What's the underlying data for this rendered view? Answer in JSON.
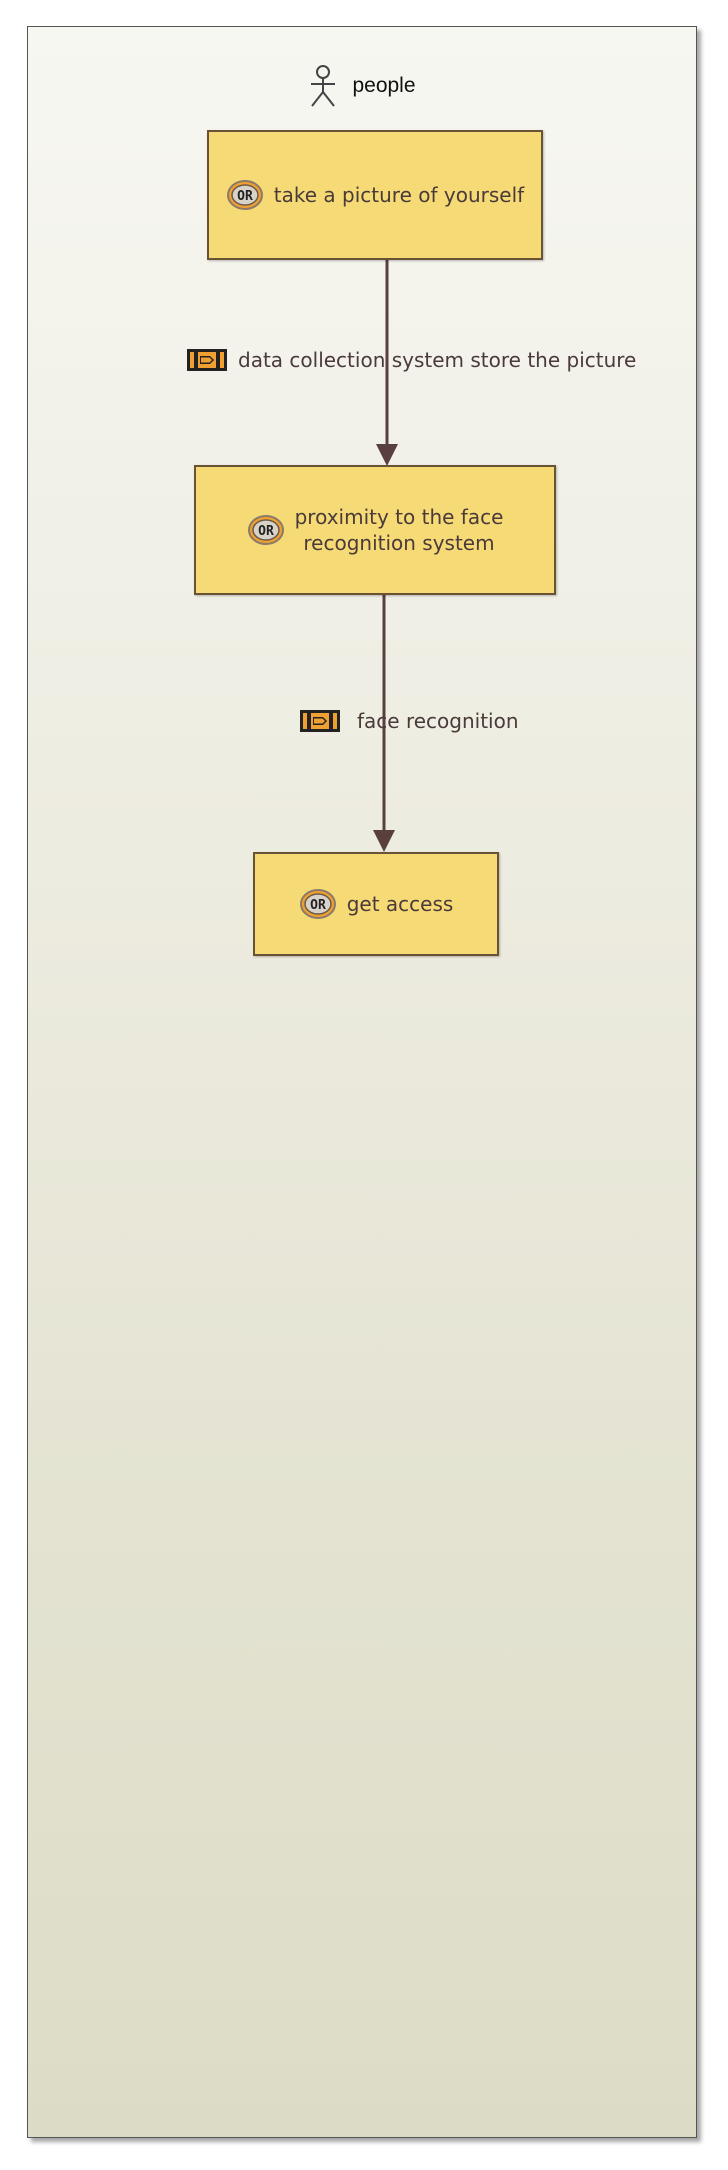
{
  "lane": {
    "title": "people",
    "icon": "actor-icon"
  },
  "nodes": [
    {
      "id": "n1",
      "label": "take a picture of yourself",
      "icon": "or-icon"
    },
    {
      "id": "n2",
      "label": "proximity to the face recognition system",
      "label_line1": "proximity to the face",
      "label_line2": "recognition system",
      "icon": "or-icon"
    },
    {
      "id": "n3",
      "label": "get access",
      "icon": "or-icon"
    }
  ],
  "edges": [
    {
      "from": "n1",
      "to": "n2",
      "label": "data collection system store the picture",
      "icon": "flag-icon"
    },
    {
      "from": "n2",
      "to": "n3",
      "label": "face recognition",
      "icon": "flag-icon"
    }
  ],
  "colors": {
    "node_fill": "#f6da76",
    "node_border": "#6a5235",
    "edge": "#5a3f3f",
    "icon_orange": "#f0a030"
  }
}
